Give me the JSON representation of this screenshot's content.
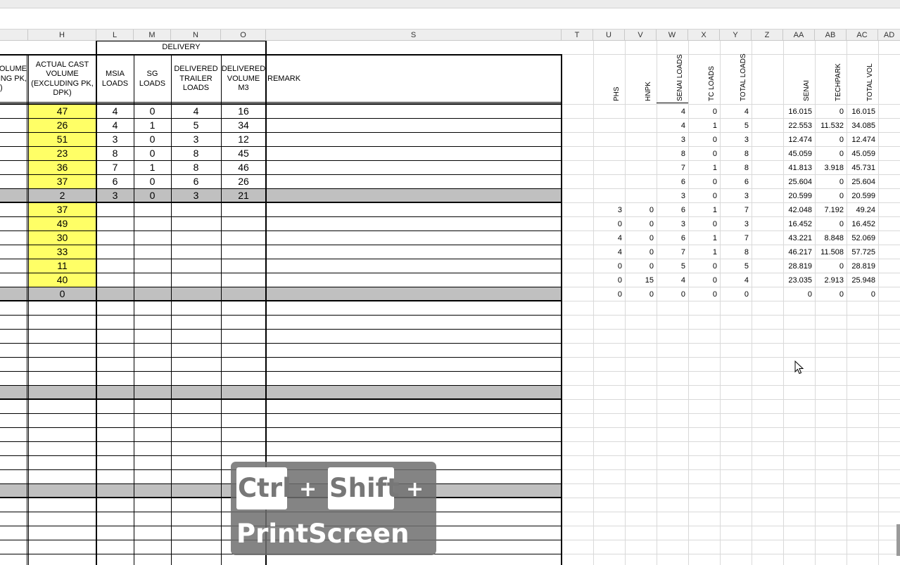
{
  "column_letters": [
    "H",
    "L",
    "M",
    "N",
    "O",
    "S",
    "T",
    "U",
    "V",
    "W",
    "X",
    "Y",
    "Z",
    "AA",
    "AB",
    "AC",
    "AD"
  ],
  "headers": {
    "delivery_group": "DELIVERY",
    "partial_left": [
      "OLUME",
      "NG PK,",
      ")"
    ],
    "actual_cast_volume": [
      "ACTUAL CAST",
      "VOLUME",
      "(EXCLUDING PK,",
      "DPK)"
    ],
    "msia_loads": [
      "MSIA",
      "LOADS"
    ],
    "sg_loads": [
      "SG",
      "LOADS"
    ],
    "delivered_trailer_loads": [
      "DELIVERED",
      "TRAILER",
      "LOADS"
    ],
    "delivered_volume_m3": [
      "DELIVERED",
      "VOLUME M3"
    ],
    "remark": "REMARK",
    "right_headers": [
      "PHS",
      "HNPK",
      "SENAI LOADS",
      "TC LOADS",
      "TOTAL LOADS",
      "SENAI",
      "TECHPARK",
      "TOTAL VOL"
    ]
  },
  "table": {
    "H": [
      "47",
      "26",
      "51",
      "23",
      "36",
      "37",
      "2",
      "37",
      "49",
      "30",
      "33",
      "11",
      "40",
      "0"
    ],
    "L": [
      "4",
      "4",
      "3",
      "8",
      "7",
      "6",
      "3"
    ],
    "M": [
      "0",
      "1",
      "0",
      "0",
      "1",
      "0",
      "0"
    ],
    "N": [
      "4",
      "5",
      "3",
      "8",
      "8",
      "6",
      "3"
    ],
    "O": [
      "16",
      "34",
      "12",
      "45",
      "46",
      "26",
      "21"
    ]
  },
  "right_rows": [
    [
      "",
      "",
      "4",
      "0",
      "4",
      "16.015",
      "0",
      "16.015"
    ],
    [
      "",
      "",
      "4",
      "1",
      "5",
      "22.553",
      "11.532",
      "34.085"
    ],
    [
      "",
      "",
      "3",
      "0",
      "3",
      "12.474",
      "0",
      "12.474"
    ],
    [
      "",
      "",
      "8",
      "0",
      "8",
      "45.059",
      "0",
      "45.059"
    ],
    [
      "",
      "",
      "7",
      "1",
      "8",
      "41.813",
      "3.918",
      "45.731"
    ],
    [
      "",
      "",
      "6",
      "0",
      "6",
      "25.604",
      "0",
      "25.604"
    ],
    [
      "",
      "",
      "3",
      "0",
      "3",
      "20.599",
      "0",
      "20.599"
    ],
    [
      "3",
      "0",
      "6",
      "1",
      "7",
      "42.048",
      "7.192",
      "49.24"
    ],
    [
      "0",
      "0",
      "3",
      "0",
      "3",
      "16.452",
      "0",
      "16.452"
    ],
    [
      "4",
      "0",
      "6",
      "1",
      "7",
      "43.221",
      "8.848",
      "52.069"
    ],
    [
      "4",
      "0",
      "7",
      "1",
      "8",
      "46.217",
      "11.508",
      "57.725"
    ],
    [
      "0",
      "0",
      "5",
      "0",
      "5",
      "28.819",
      "0",
      "28.819"
    ],
    [
      "0",
      "15",
      "4",
      "0",
      "4",
      "23.035",
      "2.913",
      "25.948"
    ],
    [
      "0",
      "0",
      "0",
      "0",
      "0",
      "0",
      "0",
      "0"
    ]
  ],
  "overlay": {
    "ctrl": "Ctrl",
    "plus1": "+",
    "shift": "Shift",
    "plus2": "+",
    "printscreen": "PrintScreen"
  },
  "colors": {
    "yellow_fill": "#ffff66",
    "gray_fill": "#c0c0c0",
    "grid": "#d9d9d9",
    "border": "#000000"
  },
  "icons": [
    "mouse-cursor-icon"
  ]
}
